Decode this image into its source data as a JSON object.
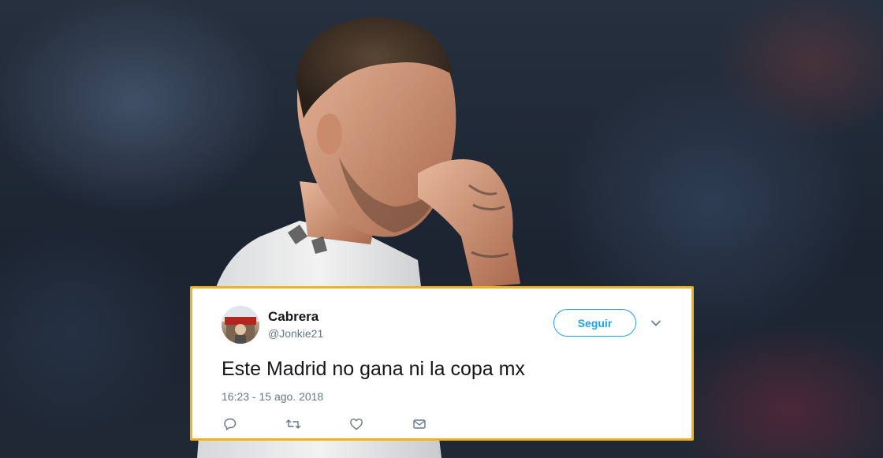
{
  "tweet": {
    "author_name": "Cabrera",
    "author_handle": "@Jonkie21",
    "follow_label": "Seguir",
    "text": "Este Madrid no gana ni la copa mx",
    "timestamp": "16:23 - 15 ago. 2018",
    "actions": [
      "reply-icon",
      "retweet-icon",
      "like-icon",
      "direct-message-icon"
    ],
    "menu_icon": "chevron-down-icon"
  },
  "colors": {
    "card_border": "#f2b21b",
    "accent": "#1da1f2",
    "text_primary": "#14171a",
    "text_secondary": "#657786"
  }
}
